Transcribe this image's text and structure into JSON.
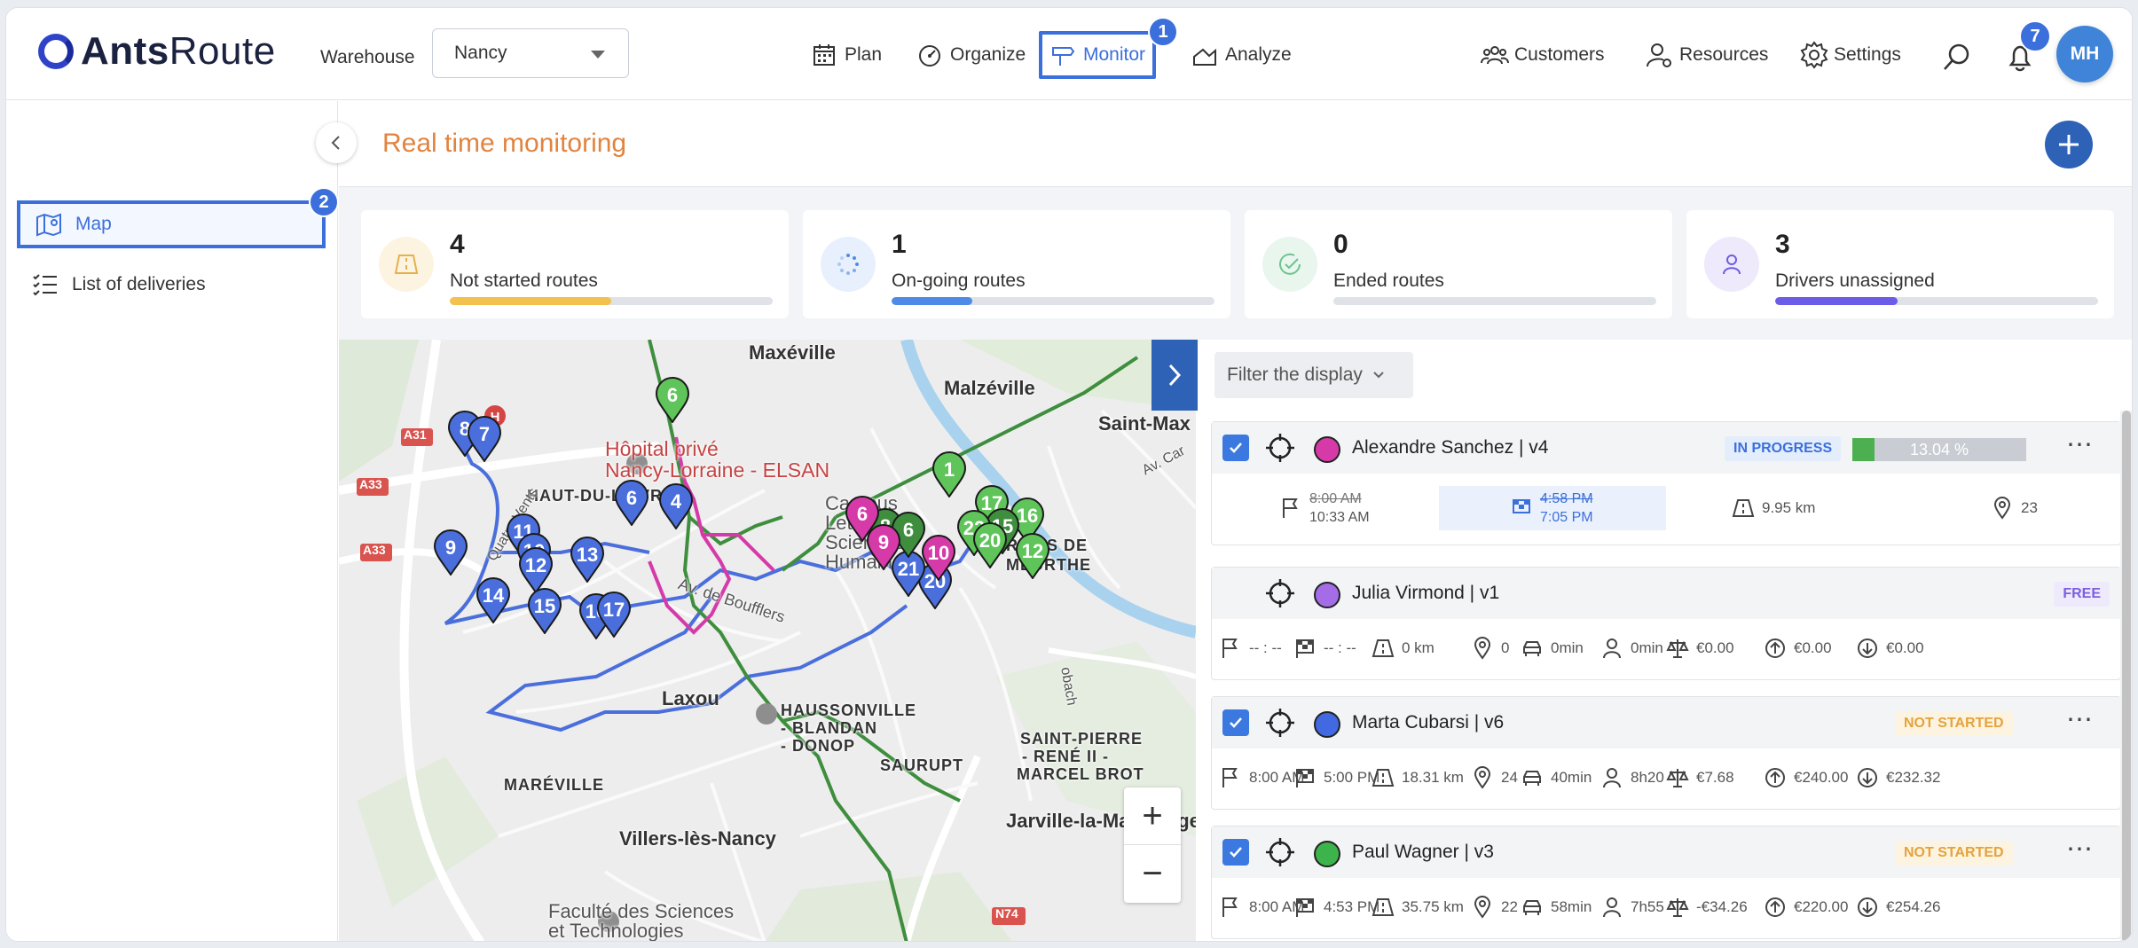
{
  "app": {
    "logo_text_bold": "Ants",
    "logo_text_light": "Route",
    "warehouse_label": "Warehouse",
    "warehouse_value": "Nancy"
  },
  "nav": {
    "plan": "Plan",
    "organize": "Organize",
    "monitor": "Monitor",
    "analyze": "Analyze",
    "monitor_badge": "1",
    "customers": "Customers",
    "resources": "Resources",
    "settings": "Settings",
    "notifications_count": "7",
    "avatar_initials": "MH"
  },
  "sidebar": {
    "items": [
      {
        "label": "Map",
        "badge": "2"
      },
      {
        "label": "List of deliveries"
      }
    ]
  },
  "page": {
    "title": "Real time monitoring"
  },
  "stats": [
    {
      "value": "4",
      "label": "Not started routes",
      "progress": 0.5,
      "color": "#f2c14e",
      "icon_bg": "#fdf3e1"
    },
    {
      "value": "1",
      "label": "On-going routes",
      "progress": 0.25,
      "color": "#4e8be8",
      "icon_bg": "#e8f0fd"
    },
    {
      "value": "0",
      "label": "Ended routes",
      "progress": 0.0,
      "color": "#6fc28f",
      "icon_bg": "#e8f6ee"
    },
    {
      "value": "3",
      "label": "Drivers unassigned",
      "progress": 0.38,
      "color": "#6c5ce7",
      "icon_bg": "#eeeafc"
    }
  ],
  "map": {
    "labels": {
      "maxeville": "Maxéville",
      "malzeville": "Malzéville",
      "saint_max": "Saint-Max",
      "hospital_1": "Hôpital privé",
      "hospital_2": "Nancy-Lorraine - ELSAN",
      "haut_du_lievre": "HAUT-DU-LIÈVRE",
      "campus_1": "Campus",
      "campus_2": "Lettres et",
      "campus_3": "Sciences",
      "campus_4": "Humaines",
      "rives_1": "RIVES DE",
      "rives_2": "MEURTHE",
      "laxou": "Laxou",
      "haussonville_1": "HAUSSONVILLE",
      "haussonville_2": "- BLANDAN",
      "haussonville_3": "- DONOP",
      "saurupt": "SAURUPT",
      "saint_pierre_1": "SAINT-PIERRE",
      "saint_pierre_2": "- RENÉ II -",
      "saint_pierre_3": "MARCEL BROT",
      "maréville": "MARÉVILLE",
      "villers": "Villers-lès-Nancy",
      "jarville": "Jarville-la-Malgrange",
      "faculte_1": "Faculté des Sciences",
      "faculte_2": "et Technologies",
      "av_boufflers": "Av. de Boufflers",
      "quatre_vents": "Quatre Vents",
      "av_carnot": "Av. Car",
      "road_a31": "A31",
      "road_a33": "A33",
      "road_a33b": "A33",
      "road_n74": "N74",
      "robach": "obach"
    },
    "pins": [
      {
        "n": "8",
        "c": "blue"
      },
      {
        "n": "7",
        "c": "blue"
      },
      {
        "n": "9",
        "c": "blue"
      },
      {
        "n": "11",
        "c": "blue"
      },
      {
        "n": "10",
        "c": "blue"
      },
      {
        "n": "12",
        "c": "blue"
      },
      {
        "n": "13",
        "c": "blue"
      },
      {
        "n": "14",
        "c": "blue"
      },
      {
        "n": "15",
        "c": "blue"
      },
      {
        "n": "16",
        "c": "blue"
      },
      {
        "n": "17",
        "c": "blue"
      },
      {
        "n": "6",
        "c": "blue"
      },
      {
        "n": "4",
        "c": "blue"
      },
      {
        "n": "20",
        "c": "blue"
      },
      {
        "n": "21",
        "c": "blue"
      },
      {
        "n": "6",
        "c": "green"
      },
      {
        "n": "1",
        "c": "green"
      },
      {
        "n": "17",
        "c": "green"
      },
      {
        "n": "16",
        "c": "green"
      },
      {
        "n": "15",
        "c": "dgreen"
      },
      {
        "n": "12",
        "c": "green"
      },
      {
        "n": "22",
        "c": "green"
      },
      {
        "n": "20",
        "c": "green"
      },
      {
        "n": "8",
        "c": "dgreen"
      },
      {
        "n": "6",
        "c": "dgreen"
      },
      {
        "n": "6",
        "c": "pink"
      },
      {
        "n": "9",
        "c": "pink"
      },
      {
        "n": "10",
        "c": "pink"
      }
    ],
    "zoom_in": "+",
    "zoom_out": "−"
  },
  "panel": {
    "filter_label": "Filter the display",
    "routes": [
      {
        "name": "Alexandre Sanchez | v4",
        "color": "#d63aa9",
        "status": "IN PROGRESS",
        "progress_label": "13.04 %",
        "progress": 0.13,
        "start_planned": "8:00 AM",
        "start_actual": "10:33 AM",
        "end_planned": "4:58 PM",
        "end_actual": "7:05 PM",
        "distance": "9.95 km",
        "stops": "23"
      },
      {
        "name": "Julia Virmond | v1",
        "color": "#a56ce8",
        "status": "FREE",
        "start": "-- : --",
        "end": "-- : --",
        "distance": "0 km",
        "stops": "0",
        "drive": "0min",
        "work": "0min",
        "cost": "€0.00",
        "revenue": "€0.00",
        "margin": "€0.00"
      },
      {
        "name": "Marta Cubarsi | v6",
        "color": "#4169e1",
        "status": "NOT STARTED",
        "start": "8:00 AM",
        "end": "5:00 PM",
        "distance": "18.31 km",
        "stops": "24",
        "drive": "40min",
        "work": "8h20",
        "cost": "€7.68",
        "revenue": "€240.00",
        "margin": "€232.32"
      },
      {
        "name": "Paul Wagner | v3",
        "color": "#3cb44b",
        "status": "NOT STARTED",
        "start": "8:00 AM",
        "end": "4:53 PM",
        "distance": "35.75 km",
        "stops": "22",
        "drive": "58min",
        "work": "7h55",
        "cost": "-€34.26",
        "revenue": "€220.00",
        "margin": "€254.26"
      }
    ]
  }
}
